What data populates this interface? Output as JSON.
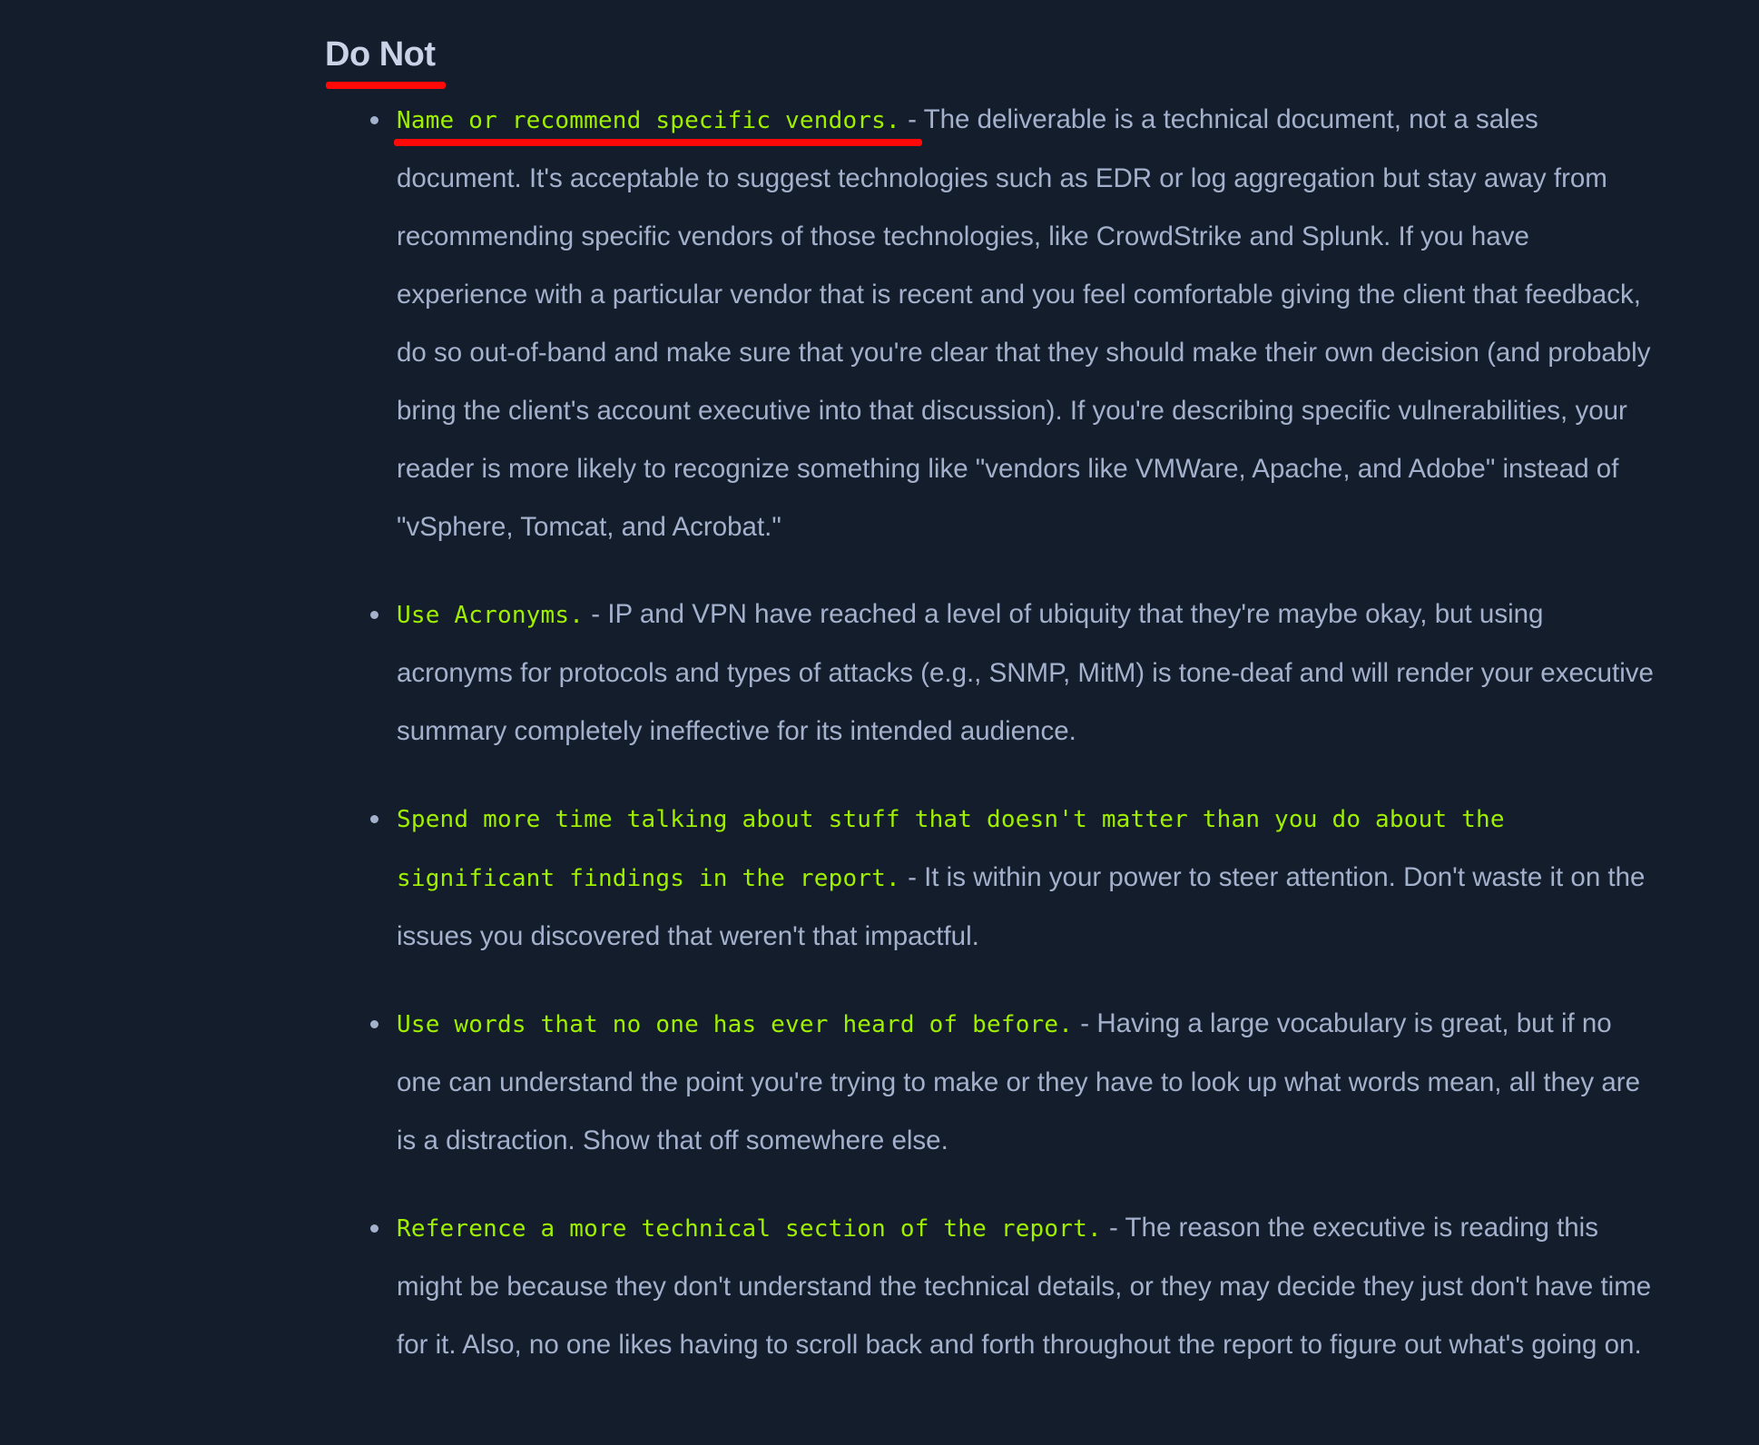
{
  "section": {
    "title": "Do Not"
  },
  "colors": {
    "background": "#141d2b",
    "body_text": "#a4b1cd",
    "term_text": "#9fef00",
    "annotation_underline": "#ff0808"
  },
  "items": [
    {
      "term": "Name or recommend specific vendors.",
      "separator": " - ",
      "text": "The deliverable is a technical document, not a sales document. It's acceptable to suggest technologies such as EDR or log aggregation but stay away from recommending specific vendors of those technologies, like CrowdStrike and Splunk. If you have experience with a particular vendor that is recent and you feel comfortable giving the client that feedback, do so out-of-band and make sure that you're clear that they should make their own decision (and probably bring the client's account executive into that discussion). If you're describing specific vulnerabilities, your reader is more likely to recognize something like \"vendors like VMWare, Apache, and Adobe\" instead of \"vSphere, Tomcat, and Acrobat.\""
    },
    {
      "term": "Use Acronyms.",
      "separator": " - ",
      "text": "IP and VPN have reached a level of ubiquity that they're maybe okay, but using acronyms for protocols and types of attacks (e.g., SNMP, MitM) is tone-deaf and will render your executive summary completely ineffective for its intended audience."
    },
    {
      "term": "Spend more time talking about stuff that doesn't matter than you do about the significant findings in the report.",
      "separator": " - ",
      "text": "It is within your power to steer attention. Don't waste it on the issues you discovered that weren't that impactful."
    },
    {
      "term": "Use words that no one has ever heard of before.",
      "separator": " - ",
      "text": "Having a large vocabulary is great, but if no one can understand the point you're trying to make or they have to look up what words mean, all they are is a distraction. Show that off somewhere else."
    },
    {
      "term": "Reference a more technical section of the report.",
      "separator": " - ",
      "text": "The reason the executive is reading this might be because they don't understand the technical details, or they may decide they just don't have time for it. Also, no one likes having to scroll back and forth throughout the report to figure out what's going on."
    }
  ]
}
